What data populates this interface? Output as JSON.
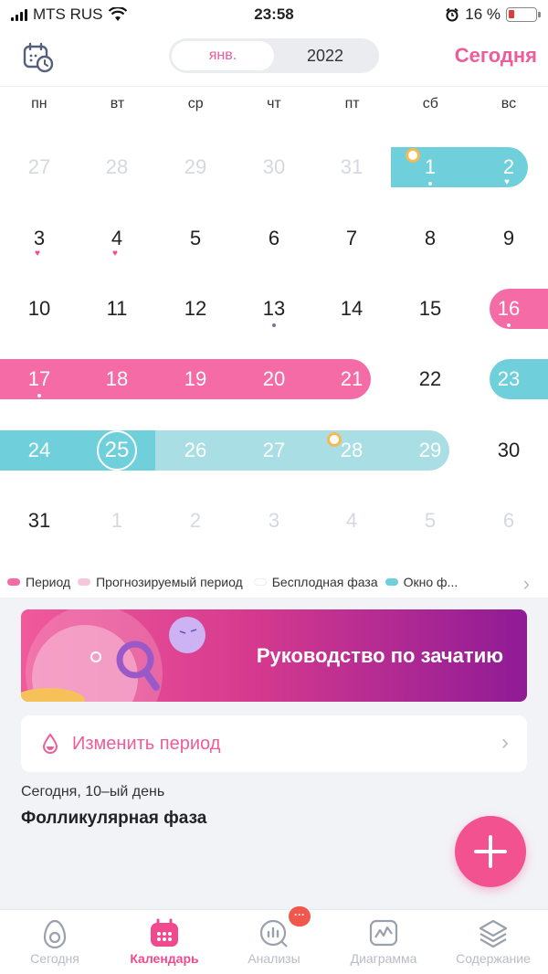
{
  "status_bar": {
    "carrier": "MTS RUS",
    "time": "23:58",
    "battery": "16 %"
  },
  "header": {
    "month": "янв.",
    "year": "2022",
    "today_button": "Сегодня"
  },
  "weekdays": [
    "пн",
    "вт",
    "ср",
    "чт",
    "пт",
    "сб",
    "вс"
  ],
  "calendar_rows": [
    [
      "27",
      "28",
      "29",
      "30",
      "31",
      "1",
      "2"
    ],
    [
      "3",
      "4",
      "5",
      "6",
      "7",
      "8",
      "9"
    ],
    [
      "10",
      "11",
      "12",
      "13",
      "14",
      "15",
      "16"
    ],
    [
      "17",
      "18",
      "19",
      "20",
      "21",
      "22",
      "23"
    ],
    [
      "24",
      "25",
      "26",
      "27",
      "28",
      "29",
      "30"
    ],
    [
      "31",
      "1",
      "2",
      "3",
      "4",
      "5",
      "6"
    ]
  ],
  "legend": {
    "items": [
      "Период",
      "Прогнозируемый период",
      "Бесплодная фаза",
      "Окно ф..."
    ]
  },
  "banner": {
    "title": "Руководство по зачатию"
  },
  "change_period": {
    "label": "Изменить период"
  },
  "cycle_info": {
    "day_text": "Сегодня, 10–ый день",
    "phase": "Фолликулярная фаза"
  },
  "tabs": [
    "Сегодня",
    "Календарь",
    "Анализы",
    "Диаграмма",
    "Содержание"
  ],
  "badge": "···",
  "colors": {
    "accent": "#ef5c9a",
    "period": "#f56ba6",
    "fertile": "#6fd0dc",
    "fertile_light": "#a9dfe4",
    "ovulation": "#f5b955"
  }
}
